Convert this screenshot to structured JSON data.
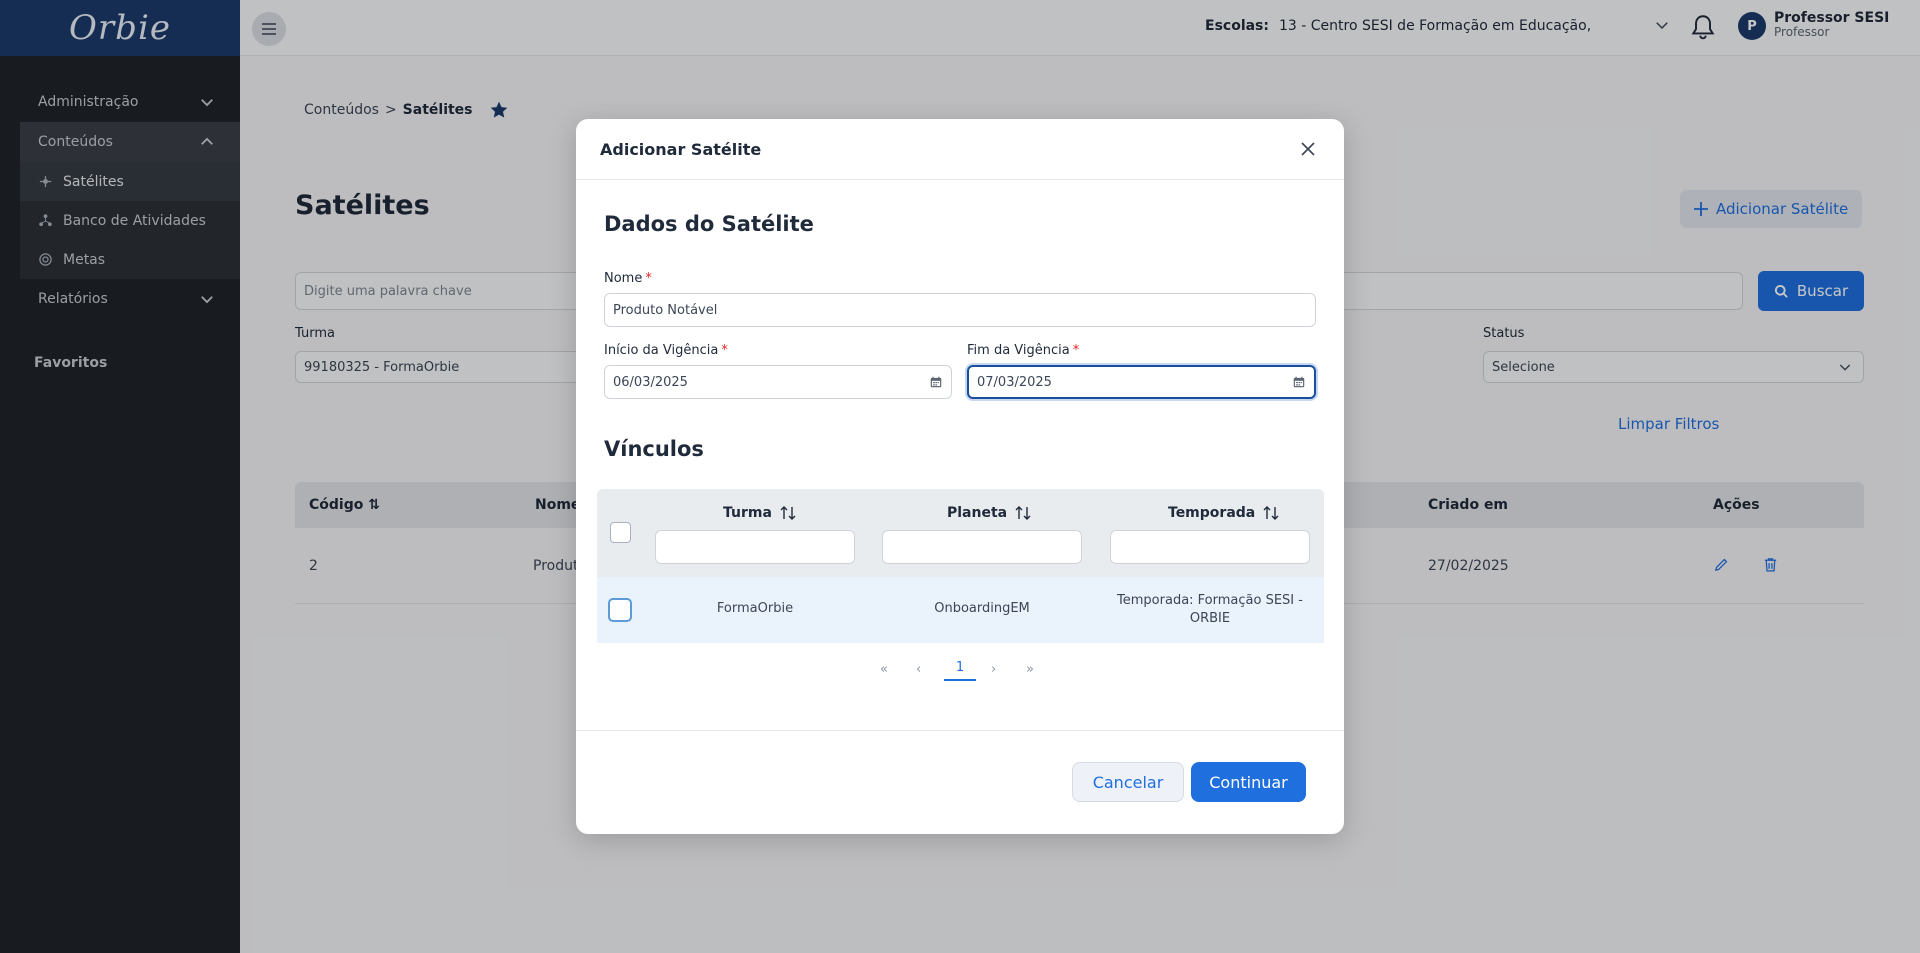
{
  "brand": {
    "logo_text": "Orbie"
  },
  "sidebar": {
    "groups": [
      {
        "label": "Administração"
      },
      {
        "label": "Conteúdos"
      },
      {
        "label": "Relatórios"
      }
    ],
    "sub_items": [
      {
        "label": "Satélites"
      },
      {
        "label": "Banco de Atividades"
      },
      {
        "label": "Metas"
      }
    ],
    "favorites_label": "Favoritos"
  },
  "topbar": {
    "escolas_label": "Escolas:",
    "escolas_value": "13 - Centro SESI de Formação em Educação,",
    "user_initial": "P",
    "user_name": "Professor SESI",
    "user_role": "Professor"
  },
  "main": {
    "breadcrumb_parent": "Conteúdos",
    "breadcrumb_sep": ">",
    "breadcrumb_current": "Satélites",
    "title": "Satélites",
    "add_button": "Adicionar Satélite",
    "search_placeholder": "Digite uma palavra chave",
    "search_button": "Buscar",
    "filters": {
      "turma_label": "Turma",
      "turma_value": "99180325 - FormaOrbie",
      "status_label": "Status",
      "status_value": "Selecione"
    },
    "clear_filters": "Limpar Filtros",
    "table": {
      "headers": [
        "Código",
        "Nome",
        "Criado em",
        "Ações"
      ],
      "rows": [
        {
          "codigo": "2",
          "nome": "Produt",
          "criado": "27/02/2025"
        }
      ]
    }
  },
  "modal": {
    "title": "Adicionar Satélite",
    "section_data": "Dados do Satélite",
    "nome_label": "Nome",
    "nome_value": "Produto Notável",
    "inicio_label": "Início da Vigência",
    "inicio_value": "06/03/2025",
    "fim_label": "Fim da Vigência",
    "fim_value": "07/03/2025",
    "required_mark": "*",
    "section_vinculos": "Vínculos",
    "vinculos_headers": [
      "Turma",
      "Planeta",
      "Temporada"
    ],
    "vinculos_rows": [
      {
        "turma": "FormaOrbie",
        "planeta": "OnboardingEM",
        "temporada": "Temporada: Formação SESI - ORBIE"
      }
    ],
    "pager": {
      "first": "«",
      "prev": "‹",
      "current": "1",
      "next": "›",
      "last": "»"
    },
    "cancel": "Cancelar",
    "continue": "Continuar"
  },
  "colors": {
    "primary": "#1f6fde",
    "sidebar": "#1f2328",
    "brand": "#1b3a6b",
    "required": "#e02424"
  }
}
